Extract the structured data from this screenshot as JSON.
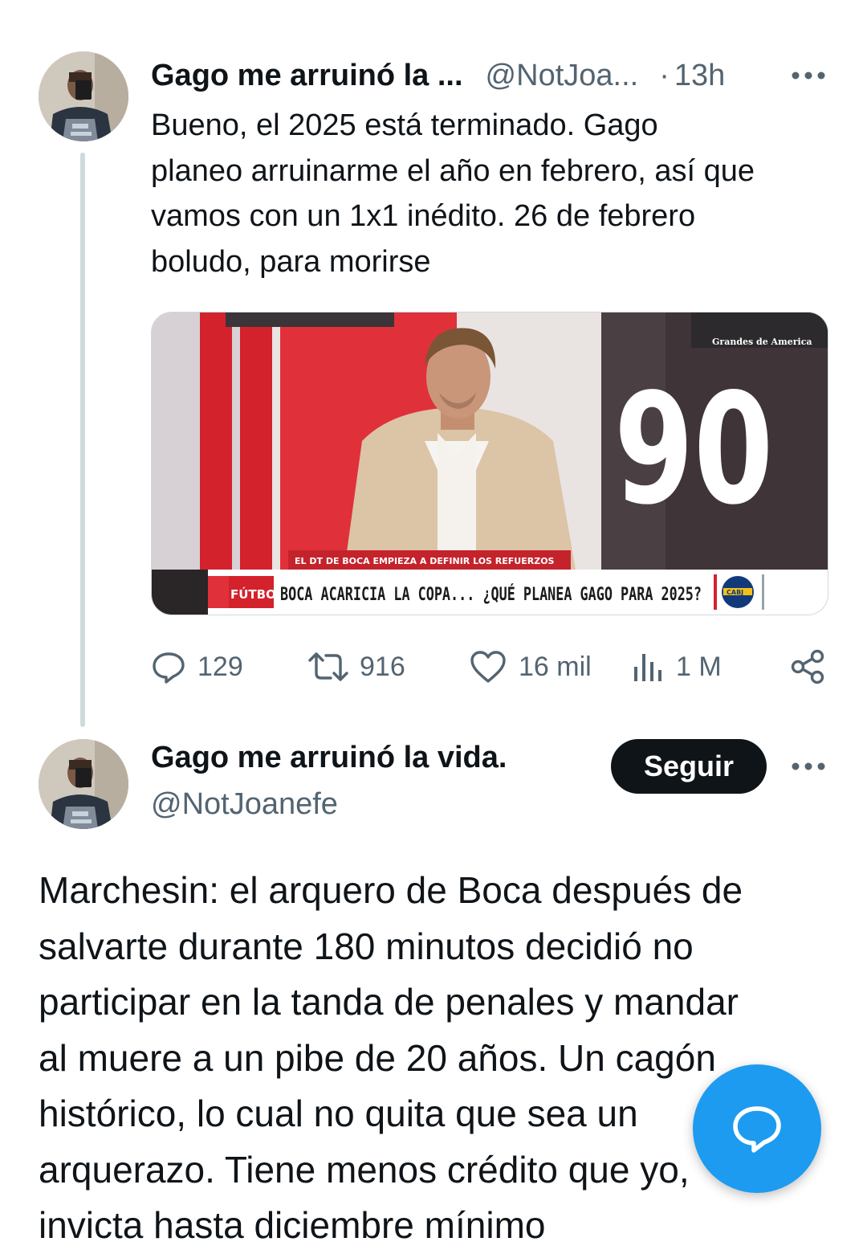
{
  "thread_tweet": {
    "author_name": "Gago me arruinó la ...",
    "handle": "@NotJoa...",
    "separator": "·",
    "time": "13h",
    "text_lines": [
      "Bueno, el 2025 está terminado. Gago",
      "planeo arruinarme el año en febrero, así que",
      "vamos con un 1x1 inédito. 26 de febrero",
      "boludo, para morirse"
    ],
    "media": {
      "corner_tag": "Grandes de America",
      "big_number": "90",
      "lower_third_small": "EL DT DE BOCA EMPIEZA A DEFINIR LOS REFUERZOS",
      "lower_third_section": "FÚTBOL",
      "lower_third_headline": "BOCA ACARICIA LA COPA... ¿QUÉ PLANEA GAGO PARA 2025?",
      "crest_text": "CABJ"
    },
    "stats": {
      "replies": "129",
      "retweets": "916",
      "likes": "16 mil",
      "views": "1 M"
    }
  },
  "main_tweet": {
    "author_name": "Gago me arruinó la vida.",
    "handle": "@NotJoanefe",
    "follow_label": "Seguir",
    "text_lines": [
      "Marchesin: el arquero de Boca después de",
      "salvarte durante 180 minutos decidió no",
      "participar en la tanda de penales y mandar",
      "al muere a un pibe de 20 años. Un cagón",
      "histórico, lo cual no quita que sea un",
      "arquerazo. Tiene menos crédito que yo,",
      "invicta hasta diciembre mínimo"
    ]
  },
  "colors": {
    "text_primary": "#0f1419",
    "text_muted": "#536471",
    "accent_blue": "#1d9bf0",
    "thread_line": "#cfd9de"
  },
  "icons": {
    "reply": "speech-bubble-icon",
    "retweet": "retweet-arrows-icon",
    "like": "heart-icon",
    "views": "bar-chart-icon",
    "share": "share-nodes-icon",
    "more": "more-dots-icon",
    "compose": "compose-reply-icon"
  }
}
